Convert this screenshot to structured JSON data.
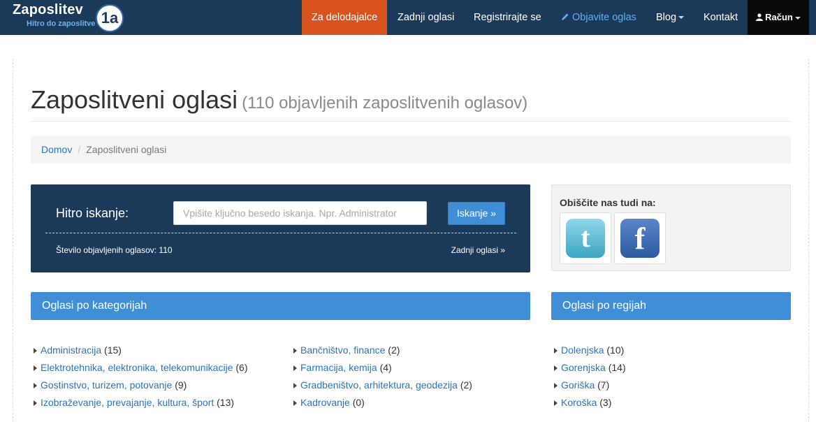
{
  "logo": {
    "main": "Zaposlitev",
    "badge": "1a",
    "tagline": "Hitro do zaposlitve"
  },
  "nav": {
    "employers": "Za delodajalce",
    "latest": "Zadnji oglasi",
    "register": "Registrirajte se",
    "post": "Objavite oglas",
    "blog": "Blog",
    "contact": "Kontakt",
    "account": "Račun"
  },
  "page": {
    "title": "Zaposlitveni oglasi",
    "subtitle": "(110 objavljenih zaposlitvenih oglasov)"
  },
  "breadcrumb": {
    "home": "Domov",
    "current": "Zaposlitveni oglasi"
  },
  "search": {
    "label": "Hitro iskanje:",
    "placeholder": "Vpišite ključno besedo iskanja. Npr. Administrator",
    "button": "Iskanje »",
    "count_text": "Število objavljenih oglasov: 110",
    "latest_link": "Zadnji oglasi »"
  },
  "social": {
    "title": "Obiščite nas tudi na:",
    "items": [
      "twitter-icon",
      "facebook-icon"
    ]
  },
  "categories": {
    "heading": "Oglasi po kategorijah",
    "col1": [
      {
        "name": "Administracija",
        "count": "(15)"
      },
      {
        "name": "Elektrotehnika, elektronika, telekomunikacije",
        "count": "(6)"
      },
      {
        "name": "Gostinstvo, turizem, potovanje",
        "count": "(9)"
      },
      {
        "name": "Izobraževanje, prevajanje, kultura, šport",
        "count": "(13)"
      }
    ],
    "col2": [
      {
        "name": "Bančništvo, finance",
        "count": "(2)"
      },
      {
        "name": "Farmacija, kemija",
        "count": "(4)"
      },
      {
        "name": "Gradbeništvo, arhitektura, geodezija",
        "count": "(2)"
      },
      {
        "name": "Kadrovanje",
        "count": "(0)"
      }
    ]
  },
  "regions": {
    "heading": "Oglasi po regijah",
    "items": [
      {
        "name": "Dolenjska",
        "count": "(10)"
      },
      {
        "name": "Gorenjska",
        "count": "(14)"
      },
      {
        "name": "Goriška",
        "count": "(7)"
      },
      {
        "name": "Koroška",
        "count": "(3)"
      }
    ]
  },
  "colors": {
    "navbar": "#1b3a5a",
    "active_nav": "#d9531e",
    "accent": "#3f8ed6",
    "link": "#2a75b9"
  }
}
